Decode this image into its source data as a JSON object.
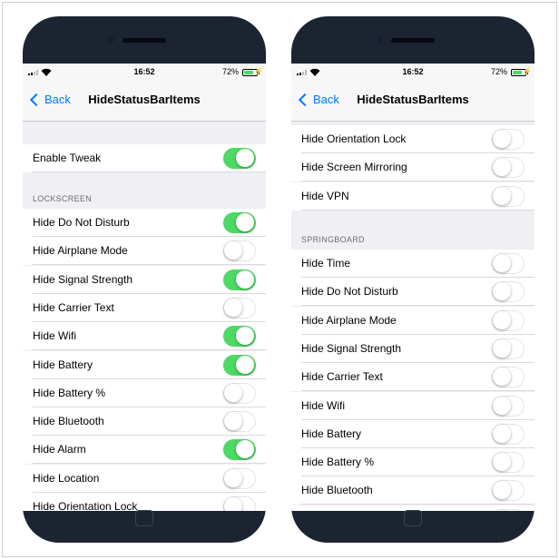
{
  "colors": {
    "accent": "#007aff",
    "toggle_on": "#4cd964",
    "phone_body": "#1c2431"
  },
  "left": {
    "status": {
      "time": "16:52",
      "battery": "72%"
    },
    "nav": {
      "back": "Back",
      "title": "HideStatusBarItems"
    },
    "enable": {
      "label": "Enable Tweak",
      "on": true
    },
    "section": "LOCKSCREEN",
    "items": [
      {
        "label": "Hide Do Not Disturb",
        "on": true
      },
      {
        "label": "Hide Airplane Mode",
        "on": false
      },
      {
        "label": "Hide Signal Strength",
        "on": true
      },
      {
        "label": "Hide Carrier Text",
        "on": false
      },
      {
        "label": "Hide Wifi",
        "on": true
      },
      {
        "label": "Hide Battery",
        "on": true
      },
      {
        "label": "Hide Battery %",
        "on": false
      },
      {
        "label": "Hide Bluetooth",
        "on": false
      },
      {
        "label": "Hide Alarm",
        "on": true
      },
      {
        "label": "Hide Location",
        "on": false
      },
      {
        "label": "Hide Orientation Lock",
        "on": false
      }
    ]
  },
  "right": {
    "status": {
      "time": "16:52",
      "battery": "72%"
    },
    "nav": {
      "back": "Back",
      "title": "HideStatusBarItems"
    },
    "top_items": [
      {
        "label": "Hide Orientation Lock",
        "on": false
      },
      {
        "label": "Hide Screen Mirroring",
        "on": false
      },
      {
        "label": "Hide VPN",
        "on": false
      }
    ],
    "section": "SPRINGBOARD",
    "items": [
      {
        "label": "Hide Time",
        "on": false
      },
      {
        "label": "Hide Do Not Disturb",
        "on": false
      },
      {
        "label": "Hide Airplane Mode",
        "on": false
      },
      {
        "label": "Hide Signal Strength",
        "on": false
      },
      {
        "label": "Hide Carrier Text",
        "on": false
      },
      {
        "label": "Hide Wifi",
        "on": false
      },
      {
        "label": "Hide Battery",
        "on": false
      },
      {
        "label": "Hide Battery %",
        "on": false
      },
      {
        "label": "Hide Bluetooth",
        "on": false
      },
      {
        "label": "",
        "on": false
      }
    ]
  }
}
